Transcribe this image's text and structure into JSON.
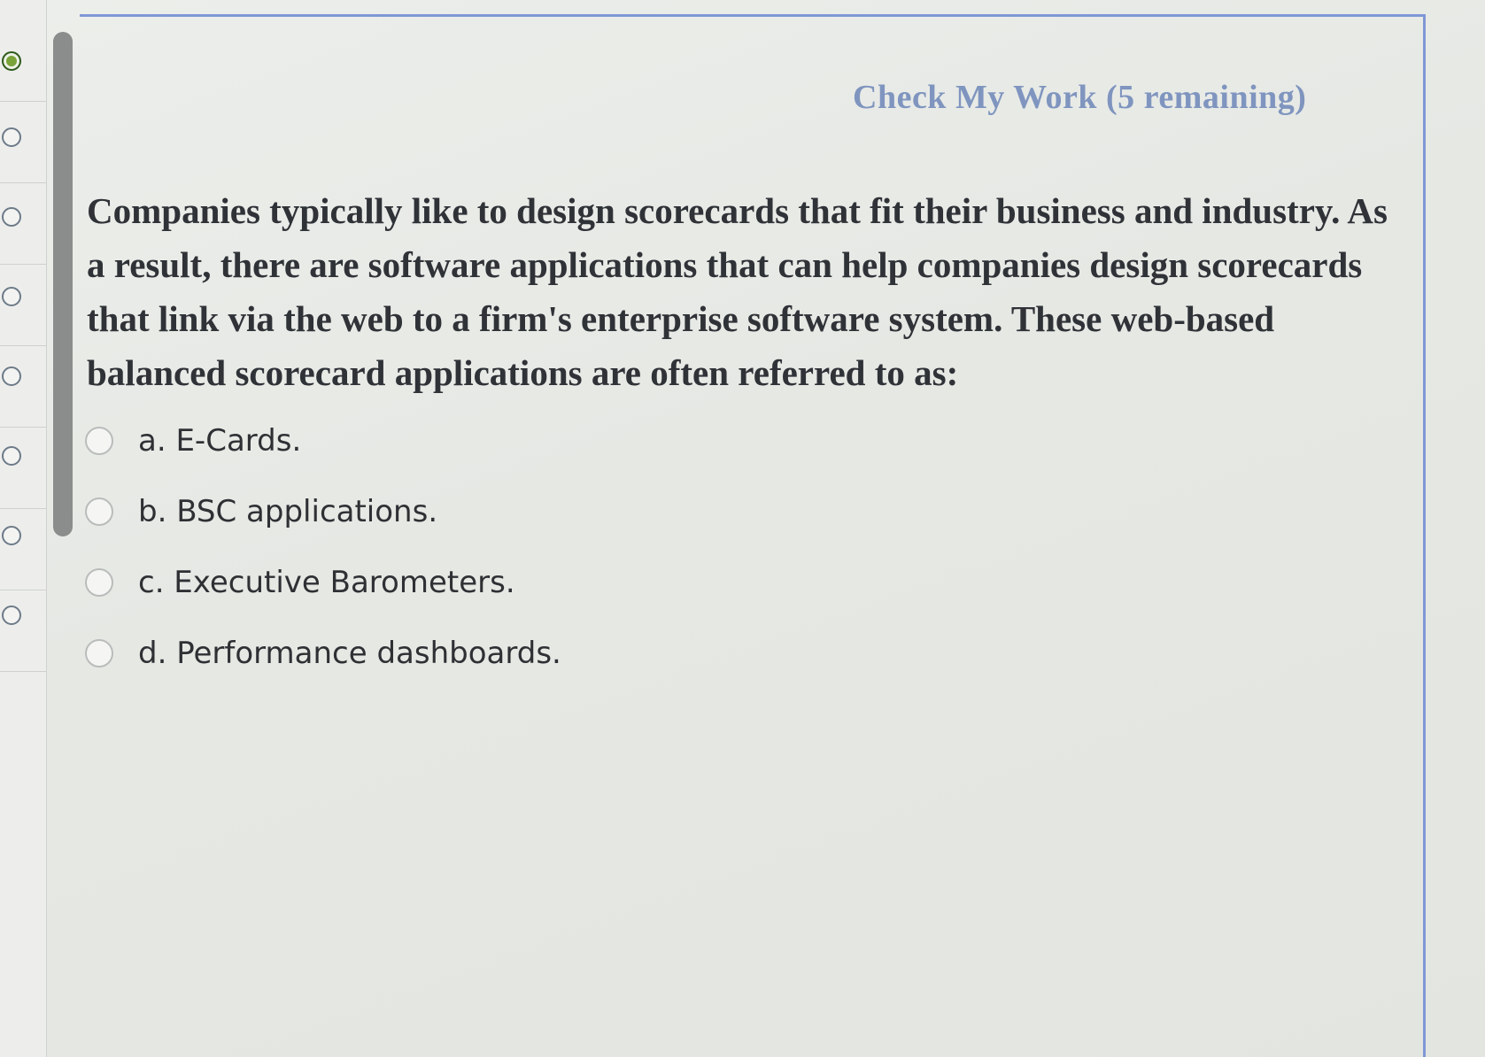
{
  "header": {
    "check_my_work": "Check My Work (5 remaining)"
  },
  "question": {
    "text": "Companies typically like to design scorecards that fit their business and industry. As a result, there are software applications that can help companies design scorecards that link via the web to a firm's enterprise software system. These web-based balanced scorecard applications are often referred to as:",
    "options": [
      {
        "label": "a. E-Cards.",
        "selected": false
      },
      {
        "label": "b. BSC applications.",
        "selected": false
      },
      {
        "label": "c. Executive Barometers.",
        "selected": false
      },
      {
        "label": "d. Performance dashboards.",
        "selected": false
      }
    ]
  },
  "navigator": {
    "items": [
      {
        "status": "completed"
      },
      {
        "status": "unanswered"
      },
      {
        "status": "unanswered"
      },
      {
        "status": "unanswered"
      },
      {
        "status": "unanswered"
      },
      {
        "status": "unanswered"
      },
      {
        "status": "unanswered"
      },
      {
        "status": "unanswered"
      }
    ]
  },
  "colors": {
    "accent": "#7f97d6",
    "check_my_work": "#7f95bf",
    "completed": "#7aa33a"
  }
}
